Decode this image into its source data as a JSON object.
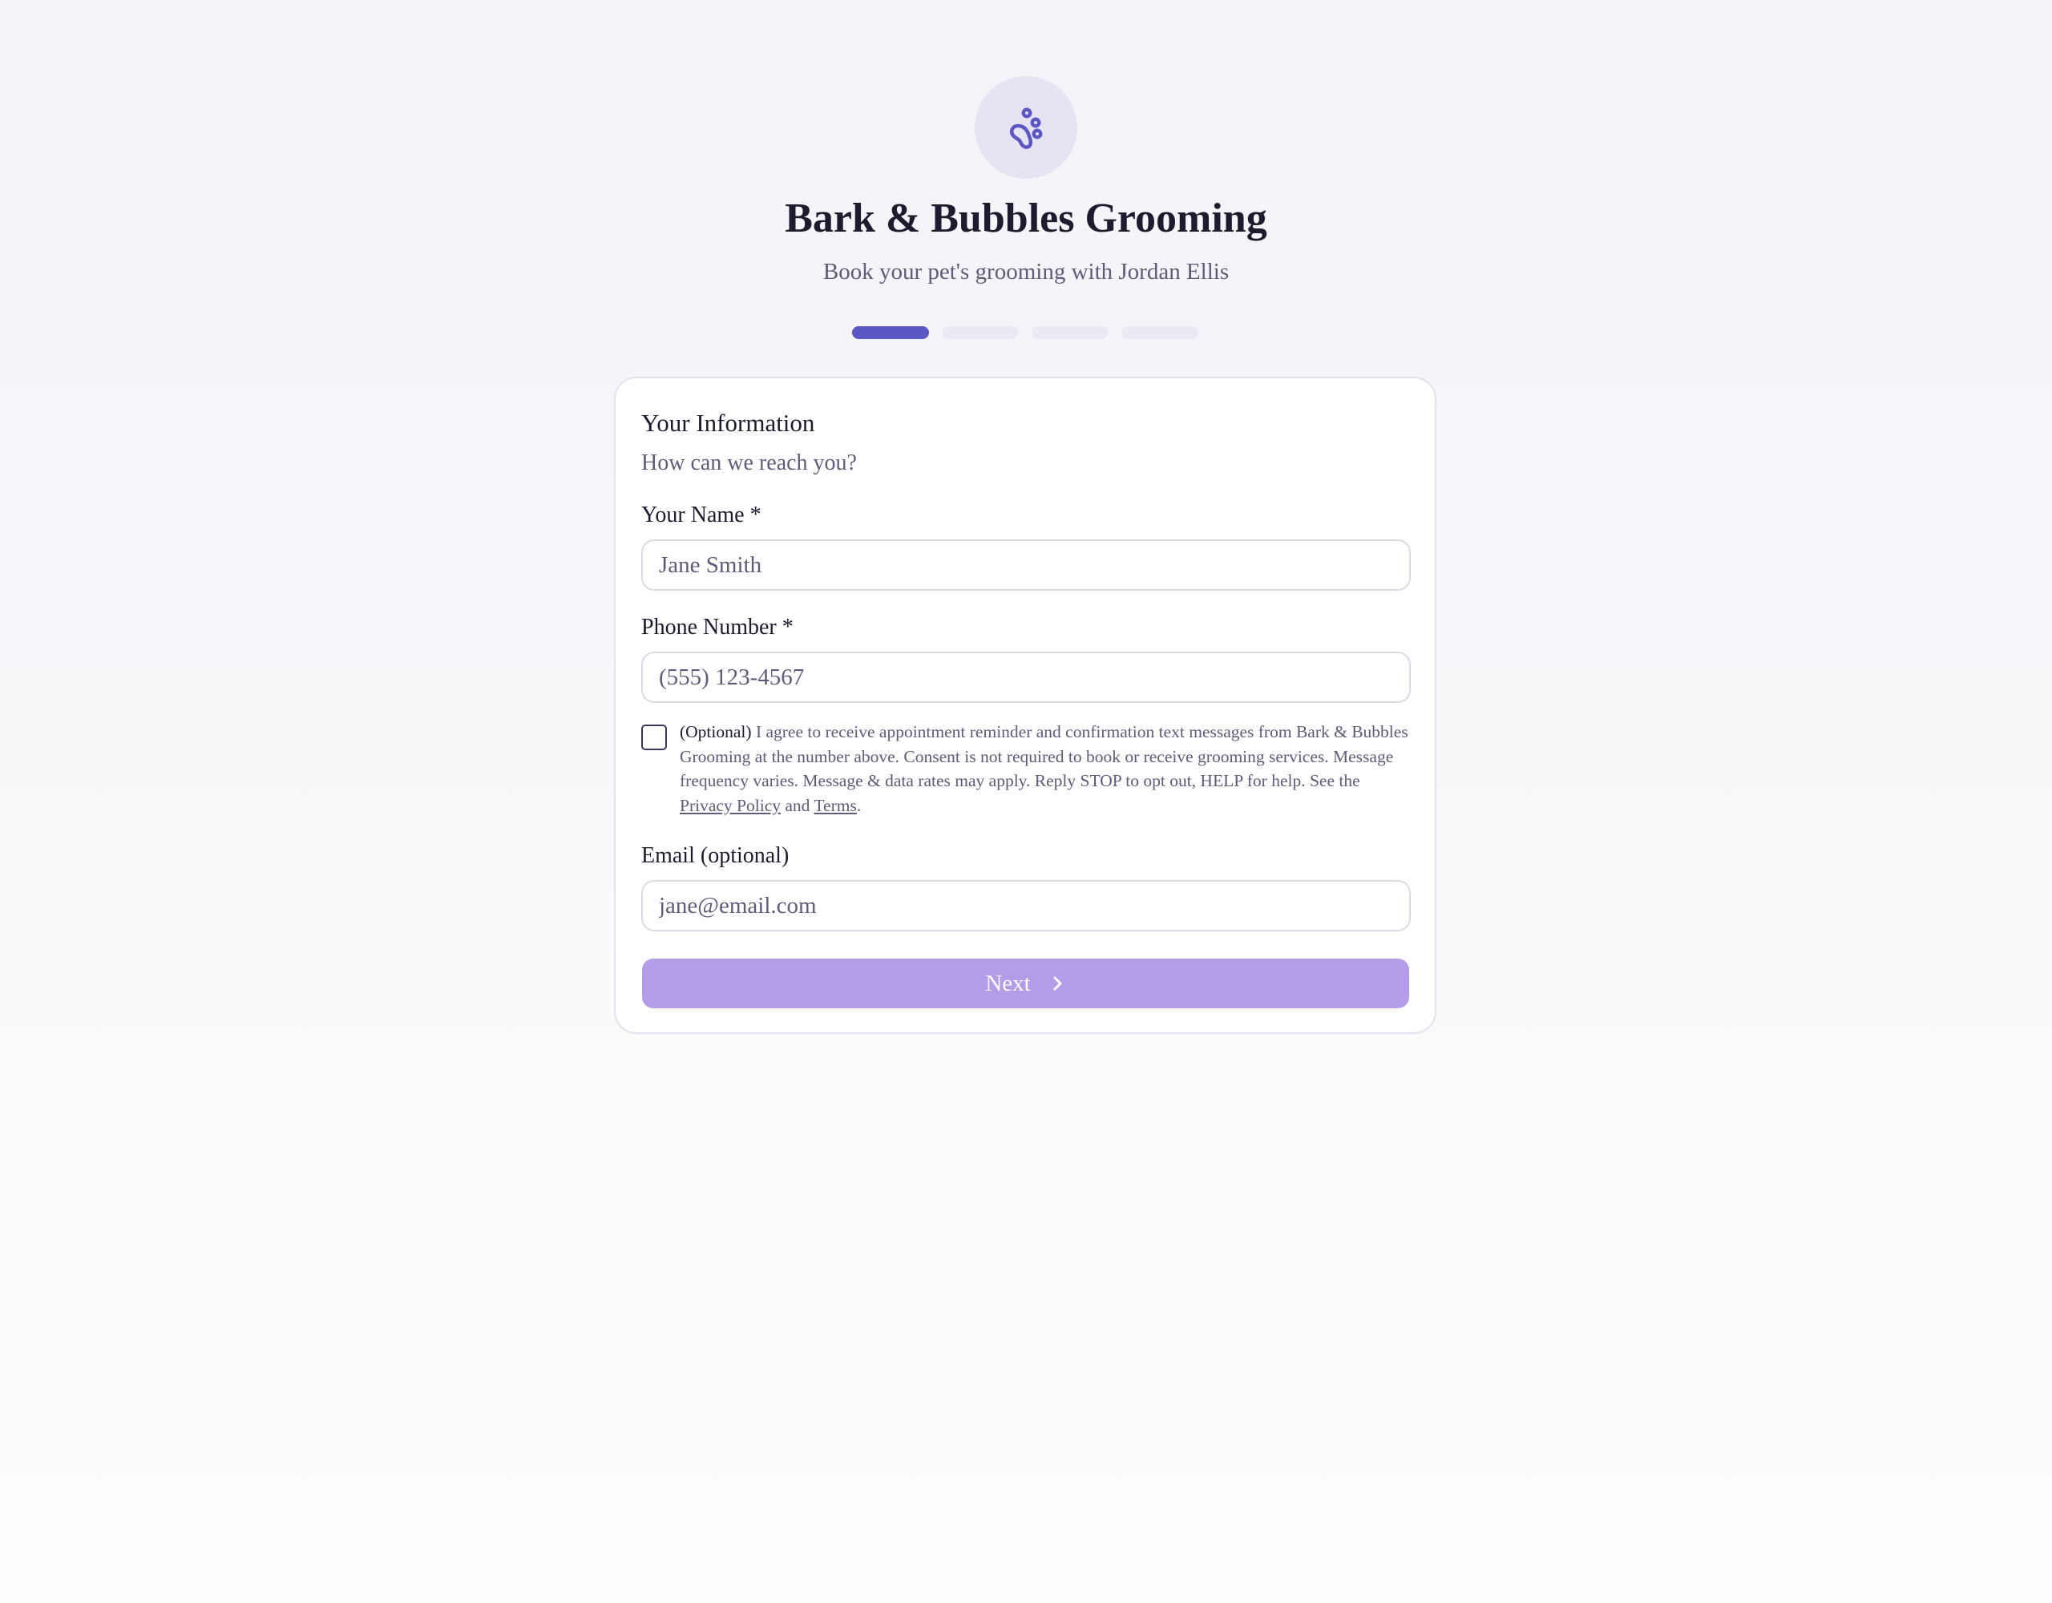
{
  "header": {
    "logo_icon": "paw-icon",
    "title": "Bark & Bubbles Grooming",
    "subtitle": "Book your pet's grooming with Jordan Ellis"
  },
  "progress": {
    "total_steps": 4,
    "current_step": 1
  },
  "form": {
    "title": "Your Information",
    "subtitle": "How can we reach you?",
    "name": {
      "label": "Your Name *",
      "value": "",
      "placeholder": "Jane Smith"
    },
    "phone": {
      "label": "Phone Number *",
      "value": "",
      "placeholder": "(555) 123-4567"
    },
    "consent": {
      "checked": false,
      "optional_label": "(Optional)",
      "text": " I agree to receive appointment reminder and confirmation text messages from Bark & Bubbles Grooming at the number above. Consent is not required to book or receive grooming services. Message frequency varies. Message & data rates may apply. Reply STOP to opt out, HELP for help. See the ",
      "privacy_link": "Privacy Policy",
      "and_text": " and ",
      "terms_link": "Terms",
      "end_text": "."
    },
    "email": {
      "label": "Email (optional)",
      "value": "",
      "placeholder": "jane@email.com"
    },
    "next_button": {
      "label": "Next",
      "icon": "chevron-right-icon"
    }
  },
  "colors": {
    "accent": "#5b57c3",
    "button_disabled": "#b39ce8",
    "logo_background": "#e6e3f3",
    "text_primary": "#1e1b2e",
    "text_secondary": "#5f5b78"
  }
}
